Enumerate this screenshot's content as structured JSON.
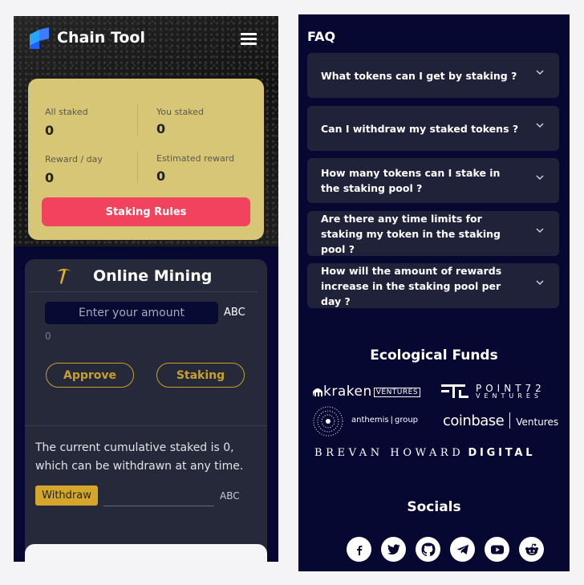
{
  "app": {
    "brand": "Chain Tool"
  },
  "stats": {
    "all_staked_label": "All staked",
    "all_staked": "0",
    "you_staked_label": "You staked",
    "you_staked": "0",
    "reward_day_label": "Reward / day",
    "reward_day": "0",
    "estimated_label": "Estimated reward",
    "estimated": "0",
    "rules_button": "Staking Rules"
  },
  "mining": {
    "title": "Online Mining",
    "amount_placeholder": "Enter your amount",
    "unit": "ABC",
    "balance": "0",
    "approve_label": "Approve",
    "staking_label": "Staking",
    "cumulative_text": "The current cumulative staked is 0, which can be withdrawn at any time.",
    "withdraw_label": "Withdraw",
    "withdraw_unit": "ABC"
  },
  "faq": {
    "title": "FAQ",
    "items": [
      {
        "q": "What tokens can I get by staking ?"
      },
      {
        "q": "Can I withdraw my staked tokens ?"
      },
      {
        "q": "How many tokens can I stake in the staking pool ?"
      },
      {
        "q": "Are there any time limits for staking my token in the staking pool ?"
      },
      {
        "q": "How will the amount of rewards increase in the staking pool per day ?"
      }
    ]
  },
  "funds": {
    "title": "Ecological Funds",
    "kraken": "kraken",
    "kraken_ventures": "VENTURES",
    "point72": "POINT72",
    "point72_sub": "VENTURES",
    "anthemis": "anthemis",
    "anthemis_group": "group",
    "coinbase": "coinbase",
    "coinbase_ventures": "Ventures",
    "brevan": "BREVAN HOWARD",
    "digital": "DIGITAL"
  },
  "socials": {
    "title": "Socials",
    "icons": [
      "facebook-icon",
      "twitter-icon",
      "github-icon",
      "telegram-icon",
      "youtube-icon",
      "reddit-icon"
    ]
  },
  "colors": {
    "accent_red": "#f2435e",
    "gold": "#c8a02a",
    "card_yellow": "#d8c677",
    "navy": "#060831"
  }
}
